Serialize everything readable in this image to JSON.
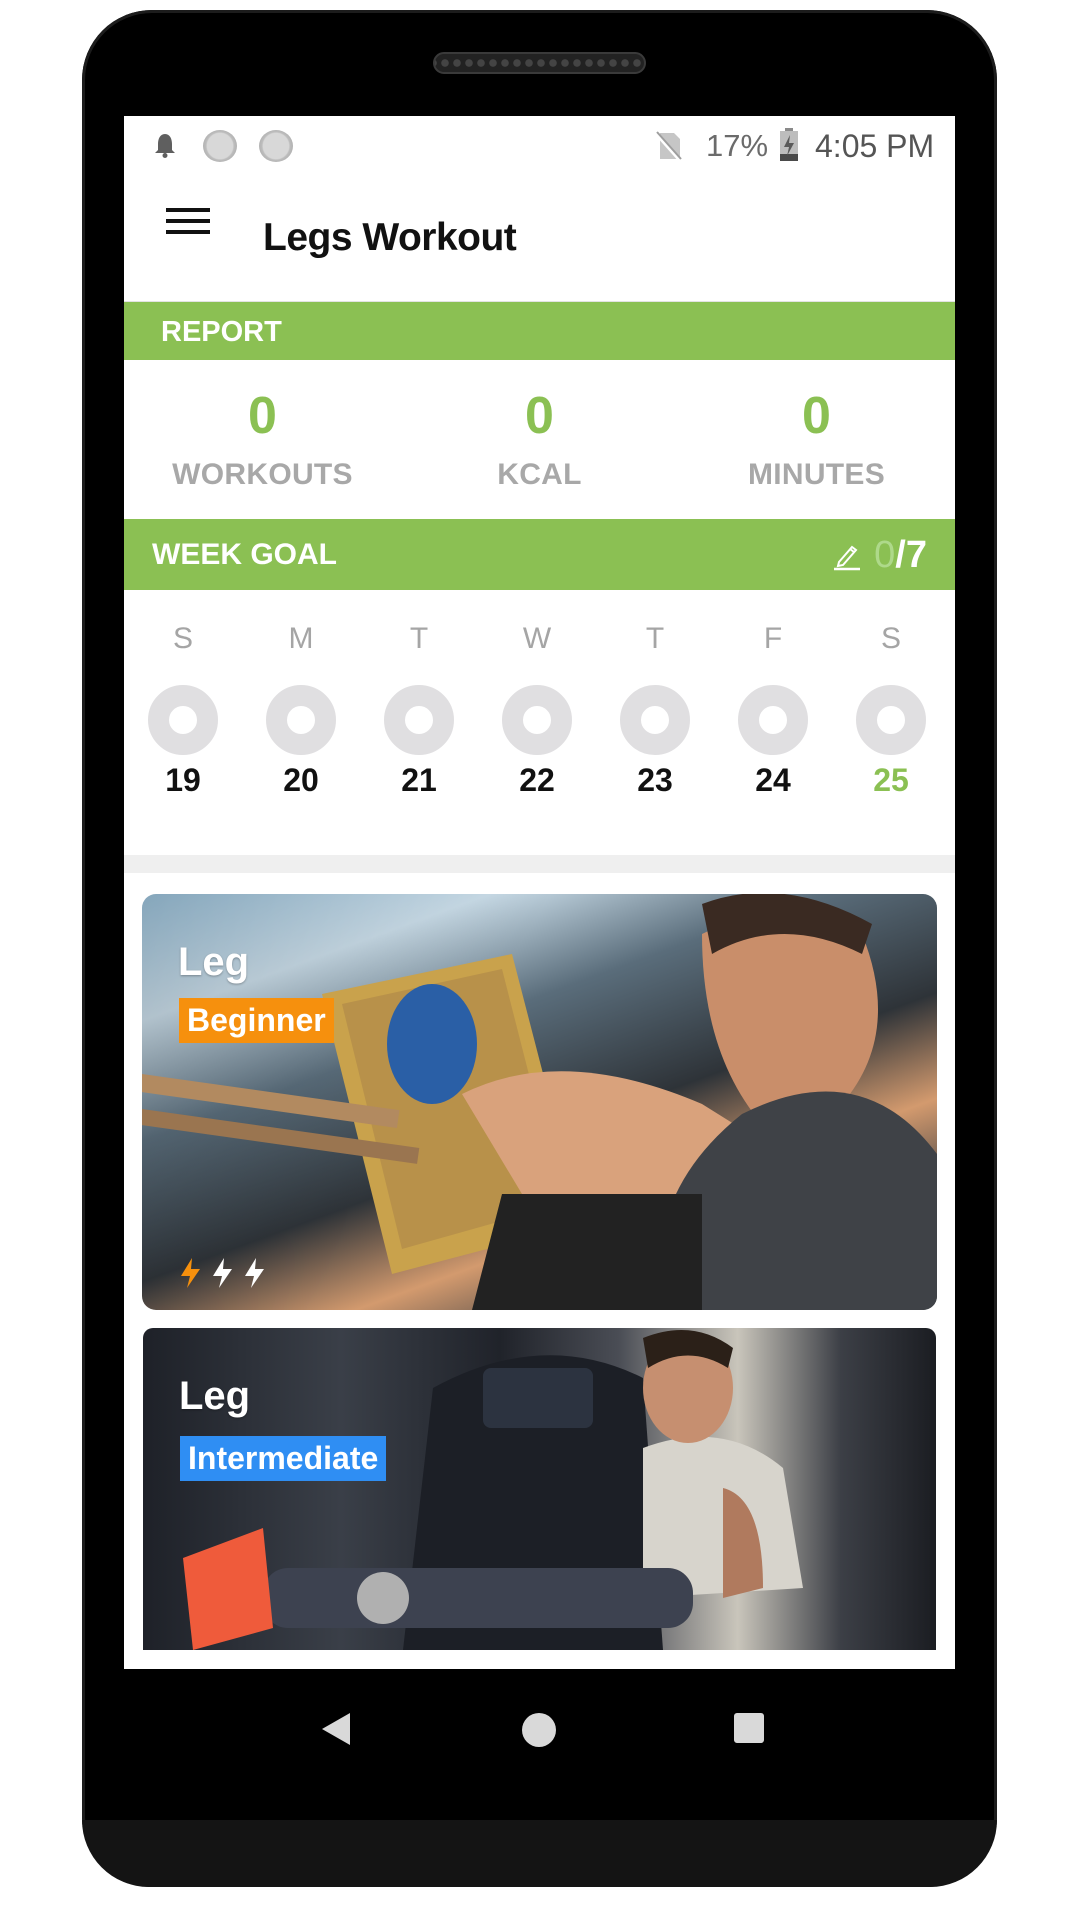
{
  "status_bar": {
    "icons": [
      "notification-bell-icon",
      "loading-dot-icon",
      "loading-dot-icon",
      "no-sim-icon",
      "battery-charging-icon"
    ],
    "battery_percent": "17%",
    "time": "4:05 PM"
  },
  "toolbar": {
    "menu_icon": "hamburger-menu-icon",
    "title": "Legs Workout"
  },
  "report": {
    "header": "REPORT",
    "stats": [
      {
        "value": "0",
        "label": "WORKOUTS"
      },
      {
        "value": "0",
        "label": "KCAL"
      },
      {
        "value": "0",
        "label": "MINUTES"
      }
    ]
  },
  "week_goal": {
    "header": "WEEK GOAL",
    "edit_icon": "pencil-icon",
    "completed": "0",
    "total": "/7",
    "days": [
      {
        "weekday": "S",
        "date": "19",
        "today": false
      },
      {
        "weekday": "M",
        "date": "20",
        "today": false
      },
      {
        "weekday": "T",
        "date": "21",
        "today": false
      },
      {
        "weekday": "W",
        "date": "22",
        "today": false
      },
      {
        "weekday": "T",
        "date": "23",
        "today": false
      },
      {
        "weekday": "F",
        "date": "24",
        "today": false
      },
      {
        "weekday": "S",
        "date": "25",
        "today": true
      }
    ]
  },
  "workouts": [
    {
      "title": "Leg",
      "level": "Beginner",
      "level_color": "#f6900d",
      "intensity": 1,
      "intensity_max": 3
    },
    {
      "title": "Leg",
      "level": "Intermediate",
      "level_color": "#2f8ef3"
    }
  ],
  "colors": {
    "accent_green": "#8bc053",
    "beginner_orange": "#f6900d",
    "intermediate_blue": "#2f8ef3",
    "ring_gray": "#e0dfe1"
  },
  "nav_bar": {
    "icons": [
      "back-icon",
      "home-icon",
      "recents-icon"
    ]
  }
}
